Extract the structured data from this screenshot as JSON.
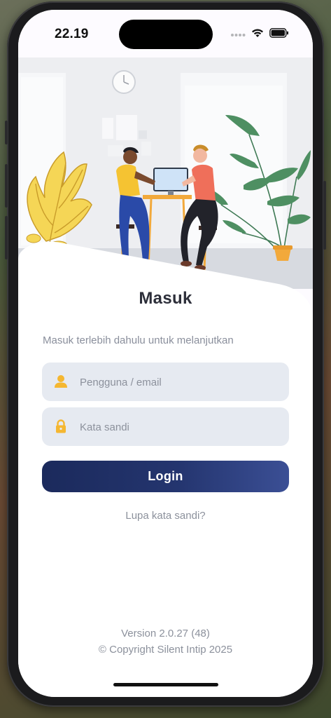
{
  "status_bar": {
    "time": "22.19",
    "icons": [
      "cellular-icon",
      "wifi-icon",
      "battery-icon"
    ]
  },
  "login": {
    "title": "Masuk",
    "subtitle": "Masuk terlebih dahulu untuk melanjutkan",
    "username_placeholder": "Pengguna / email",
    "username_icon": "user-icon",
    "password_placeholder": "Kata sandi",
    "password_icon": "lock-icon",
    "login_button": "Login",
    "forgot_link": "Lupa kata sandi?"
  },
  "footer": {
    "version": "Version 2.0.27 (48)",
    "copyright": "© Copyright Silent Intip 2025"
  },
  "colors": {
    "primary_button": "#1b2a5c",
    "field_bg": "#e6eaf1",
    "icon_accent": "#f5b731",
    "muted_text": "#8c919c"
  }
}
